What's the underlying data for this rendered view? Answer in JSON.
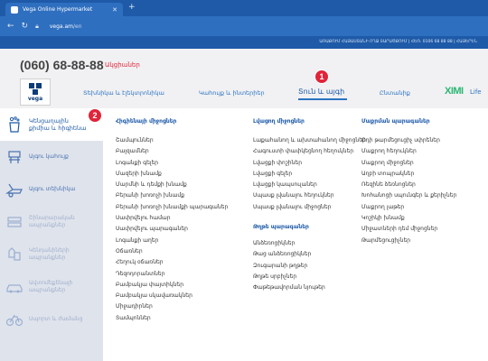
{
  "browser": {
    "tab_title": "Vega Online Hypermarket",
    "url_host": "vega.am",
    "url_path": "/en"
  },
  "infobar": {
    "text": "ԱՌԱՔՈՒՄ ՀԱՅԱՍՏԱՆԻ ՈՂՋ ՏԱՐԱԾՔՈՒՄ | ՀԵՌ. 0106 68 88 88 | ՀԱՅԵՐԵՆ"
  },
  "header": {
    "phone": "(060) 68-88-88",
    "promo": "Ակցիաներ",
    "logo_text": "vega",
    "nav": [
      {
        "label": "Տեխնիկա և էլեկտրոնիկա"
      },
      {
        "label": "Կահույք և ինտերիեր"
      },
      {
        "label": "Տուն և այգի"
      },
      {
        "label": "Ընտանիք"
      }
    ],
    "nav_logo": "XIMI",
    "nav_logo_suffix": "Life"
  },
  "annotations": {
    "badge_1": "1",
    "badge_2": "2"
  },
  "sidebar": {
    "items": [
      {
        "label": "Կենցաղային քիմիա և հիգիենա",
        "icon": "cleaning-icon"
      },
      {
        "label": "Այգու կահույք",
        "icon": "garden-furniture-icon"
      },
      {
        "label": "Այգու տեխնիկա",
        "icon": "garden-tools-icon"
      },
      {
        "label": "Շինարարական ապրանքներ",
        "icon": "construction-icon"
      },
      {
        "label": "Կենդանիների ապրանքներ",
        "icon": "pet-icon"
      },
      {
        "label": "Ավտոմեքենայի ապրանքներ",
        "icon": "car-icon"
      },
      {
        "label": "Սպորտ և ժամանց",
        "icon": "bike-icon"
      }
    ]
  },
  "columns": [
    {
      "heading": "Հիգիենայի միջոցներ",
      "links": [
        "Շամպուններ",
        "Բալզամներ",
        "Լոգանքի գելեր",
        "Մազերի խնամք",
        "Մարմնի և դեմքի խնամք",
        "Բերանի խոռոչի խնամք",
        "Բերանի խոռոչի խնամքի պարագաներ",
        "Սափրվելու համար",
        "Սափրվելու պարագաներ",
        "Լոգանքի աղեր",
        "Օճառներ",
        "Հեղուկ օճառներ",
        "Դեզոդորանտներ",
        "Բամբակյա փայտիկներ",
        "Բամբակյա սկավառակներ",
        "Միջադիրներ",
        "Տամպոններ"
      ]
    },
    {
      "heading": "Լվացող միջոցներ",
      "links": [
        "Լաքահանող և ախտահանող միջոցներ",
        "Հագուստի փափկեցնող հեղուկներ",
        "Լվացքի փոշիներ",
        "Լվացքի գելեր",
        "Լվացքի կապսուլաներ",
        "Սպասք լվանալու հեղուկներ",
        "Սպասք լվանալու միջոցներ"
      ],
      "subheading": "Թղթե պարագաներ",
      "sublinks": [
        "Անձեռոցիկներ",
        "Թաց անձեռոցիկներ",
        "Զուգարանի թղթեր",
        "Թղթե սրբիչներ",
        "Փաթեթավորման նյութեր"
      ]
    },
    {
      "heading": "Մաքրման պարագաներ",
      "links": [
        "Օդի թարմեցուցիչ սփրեներ",
        "Մաքրող հեղուկներ",
        "Մաքրող միջոցներ",
        "Աղբի տոպրակներ",
        "Ռեզինե ձեռնոցներ",
        "Խոհանոցի սպունգեր և քերիչներ",
        "Մաքրող լաթեր",
        "Կոշիկի խնամք",
        "Միջատների դեմ միջոցներ",
        "Թարմեցուցիչներ"
      ]
    }
  ]
}
